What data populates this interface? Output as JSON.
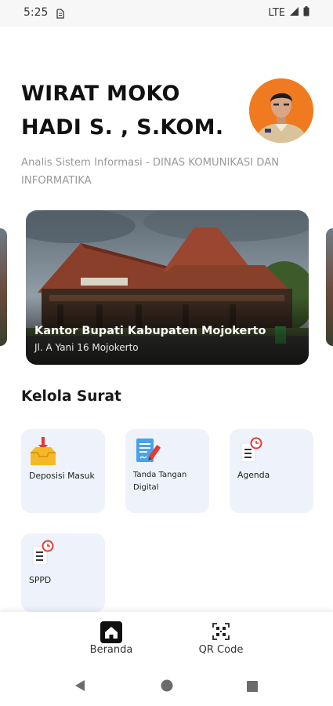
{
  "status_bar": {
    "time": "5:25",
    "network": "LTE"
  },
  "profile": {
    "name_line1": "WIRAT MOKO",
    "name_line2": "HADI S. , S.KOM.",
    "role": "Analis Sistem Informasi - DINAS KOMUNIKASI DAN INFORMATIKA"
  },
  "banner": {
    "title": "Kantor Bupati Kabupaten Mojokerto",
    "address": "Jl. A Yani 16 Mojokerto"
  },
  "section": {
    "title": "Kelola Surat"
  },
  "menu": {
    "items": [
      {
        "label": "Deposisi Masuk",
        "icon": "inbox-tray-icon"
      },
      {
        "label": "Tanda Tangan Digital",
        "icon": "signature-document-icon"
      },
      {
        "label": "Agenda",
        "icon": "agenda-clock-icon"
      },
      {
        "label": "SPPD",
        "icon": "sppd-clock-icon"
      }
    ]
  },
  "bottom_nav": {
    "home_label": "Beranda",
    "qr_label": "QR Code"
  },
  "colors": {
    "card_bg": "#eef2fb",
    "accent_red": "#e53935",
    "folder_yellow": "#f5b928",
    "avatar_orange": "#f07a1f"
  }
}
